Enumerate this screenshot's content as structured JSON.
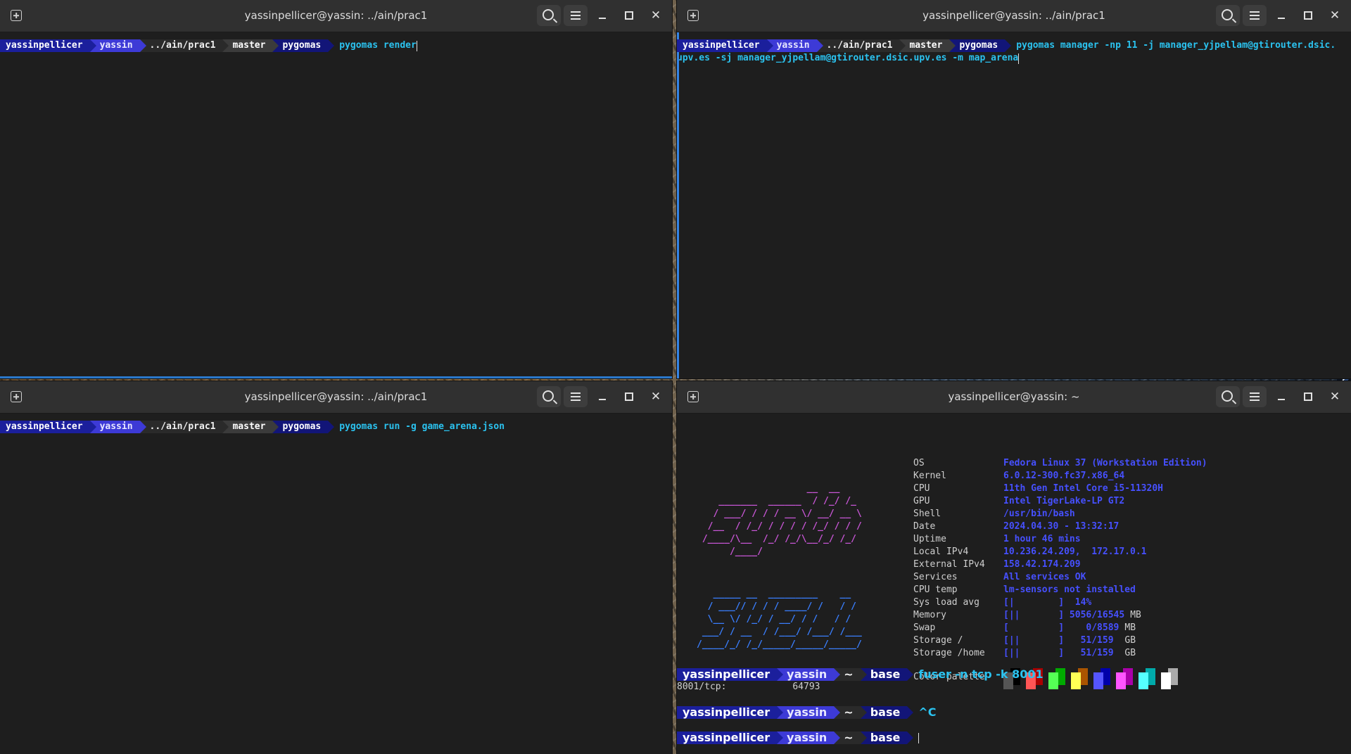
{
  "prompt": {
    "user": "yassinpellicer",
    "host": "yassin",
    "path_prac": "../ain/prac1",
    "path_home": "~",
    "git_branch": "master",
    "env_pygomas": "pygomas",
    "env_base": "base"
  },
  "windows": {
    "top_left": {
      "title": "yassinpellicer@yassin: ../ain/prac1",
      "command": "pygomas render"
    },
    "top_right": {
      "title": "yassinpellicer@yassin: ../ain/prac1",
      "command_line1": "pygomas manager -np 11 -j manager_yjpellam@gtirouter.dsic.",
      "command_line2": "upv.es -sj manager_yjpellam@gtirouter.dsic.upv.es -m map_arena"
    },
    "bottom_left": {
      "title": "yassinpellicer@yassin: ../ain/prac1",
      "command": "pygomas run -g game_arena.json"
    },
    "bottom_right": {
      "title": "yassinpellicer@yassin: ~",
      "ascii_logo_top": "                    __  __\n    _______  ______  / /_/ /_\n   / ___/ / / / __ \\/ __/ __ \\\n  /__  / /_/ / / / / /_/ / / /\n /____/\\__  /_/ /_/\\__/_/ /_/\n      /____/",
      "ascii_logo_bottom": "   _____ __  _________    __\n  / ___// / / / ____/ /   / /\n  \\__ \\/ /_/ / __/ / /   / /\n ___/ / __  / /___/ /___/ /___\n/____/_/ /_/_____/_____/_____/",
      "sysinfo": [
        {
          "key": "OS",
          "value": "Fedora Linux 37 (Workstation Edition)"
        },
        {
          "key": "Kernel",
          "value": "6.0.12-300.fc37.x86_64"
        },
        {
          "key": "CPU",
          "value": "11th Gen Intel Core i5-11320H"
        },
        {
          "key": "GPU",
          "value": "Intel TigerLake-LP GT2"
        },
        {
          "key": "Shell",
          "value": "/usr/bin/bash"
        },
        {
          "key": "Date",
          "value": "2024.04.30 - 13:32:17"
        },
        {
          "key": "Uptime",
          "value": "1 hour 46 mins"
        },
        {
          "key": "Local IPv4",
          "value": "10.236.24.209,  172.17.0.1"
        },
        {
          "key": "External IPv4",
          "value": "158.42.174.209"
        },
        {
          "key": "Services",
          "value": "All services OK"
        },
        {
          "key": "CPU temp",
          "value": "lm-sensors not installed"
        },
        {
          "key": "Sys load avg",
          "value": "[|        ]  14%"
        },
        {
          "key": "Memory",
          "value": "[||       ] 5056/16545",
          "unit": "MB"
        },
        {
          "key": "Swap",
          "value": "[         ]    0/8589",
          "unit": "MB"
        },
        {
          "key": "Storage /",
          "value": "[||       ]   51/159 ",
          "unit": "GB"
        },
        {
          "key": "Storage /home",
          "value": "[||       ]   51/159 ",
          "unit": "GB"
        }
      ],
      "palette_label": "Color palette",
      "palette": [
        {
          "lo": "#555555",
          "hi": "#000000"
        },
        {
          "lo": "#ff5555",
          "hi": "#aa0000"
        },
        {
          "lo": "#55ff55",
          "hi": "#00aa00"
        },
        {
          "lo": "#ffff55",
          "hi": "#aa5500"
        },
        {
          "lo": "#5555ff",
          "hi": "#0000aa"
        },
        {
          "lo": "#ff55ff",
          "hi": "#aa00aa"
        },
        {
          "lo": "#55ffff",
          "hi": "#00aaaa"
        },
        {
          "lo": "#ffffff",
          "hi": "#aaaaaa"
        }
      ],
      "cmd1": "fuser -n tcp -k 8001",
      "output1": "8001/tcp:            64793",
      "cmd2": "^C"
    }
  }
}
